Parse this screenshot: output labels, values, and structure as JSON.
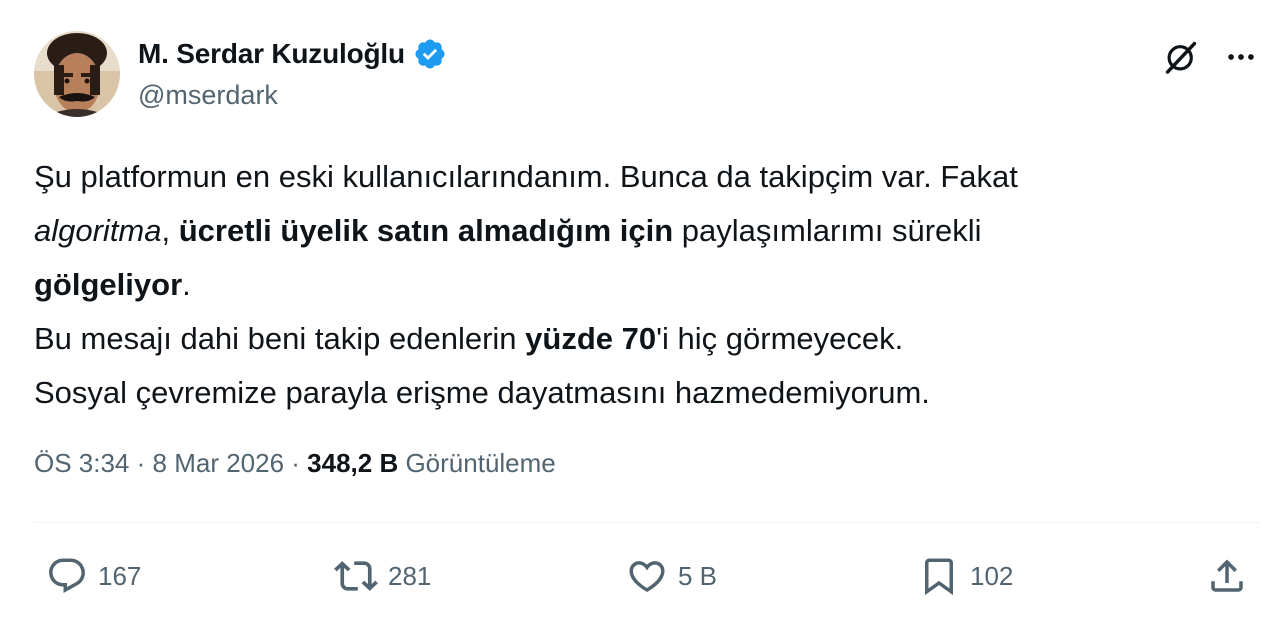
{
  "author": {
    "display_name": "M. Serdar Kuzuloğlu",
    "handle": "@mserdark"
  },
  "colors": {
    "verified_badge": "#1d9bf0",
    "text_primary": "#0f1419",
    "text_secondary": "#536471"
  },
  "icons": {
    "top": [
      "grok-icon",
      "more-icon"
    ],
    "actions": [
      "reply-icon",
      "retweet-icon",
      "like-icon",
      "bookmark-icon",
      "share-icon"
    ]
  },
  "text": {
    "line1": "Şu platformun en eski kullanıcılarındanım. Bunca da takipçim var. Fakat",
    "algoritma": "algoritma",
    "comma": ", ",
    "bold_uyelik": "ücretli üyelik satın almadığım için",
    "paylasimlar": " paylaşımlarımı sürekli",
    "bold_golgeliyor": "gölgeliyor",
    "period1": ".",
    "line3_start": "Bu mesajı dahi beni takip edenlerin ",
    "bold_yuzde": "yüzde 70",
    "line3_end": "'i hiç görmeyecek.",
    "line4": "Sosyal çevremize parayla erişme dayatmasını hazmedemiyorum."
  },
  "meta": {
    "time": "ÖS 3:34",
    "sep1": " · ",
    "date": "8 Mar 2026",
    "sep2": " · ",
    "views_count": "348,2 B",
    "views_label": " Görüntüleme"
  },
  "actions": {
    "reply_count": "167",
    "retweet_count": "281",
    "like_count": "5 B",
    "bookmark_count": "102"
  }
}
